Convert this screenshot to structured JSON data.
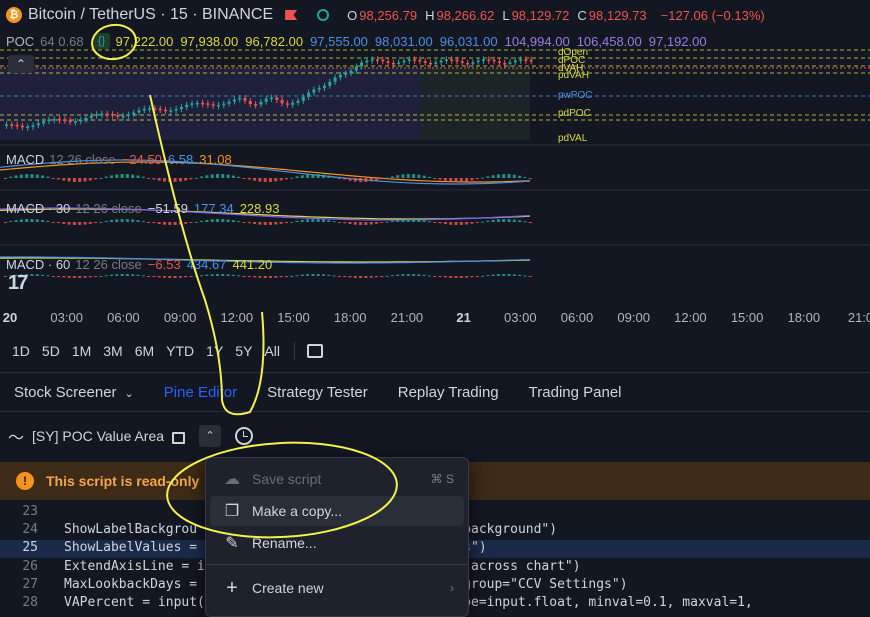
{
  "header": {
    "symbol": "Bitcoin / TetherUS · 15 · BINANCE",
    "ohlc": [
      {
        "k": "O",
        "v": "98,256.79"
      },
      {
        "k": "H",
        "v": "98,266.62"
      },
      {
        "k": "L",
        "v": "98,129.72"
      },
      {
        "k": "C",
        "v": "98,129.73"
      }
    ],
    "change": "−127.06 (−0.13%)"
  },
  "poc_indicator": {
    "label": "POC",
    "args": "64 0.68",
    "values": [
      {
        "v": "97,222.00",
        "color": "#d9d940"
      },
      {
        "v": "97,938.00",
        "color": "#d9d940"
      },
      {
        "v": "96,782.00",
        "color": "#d9d940"
      },
      {
        "v": "97,555.00",
        "color": "#4a90e2"
      },
      {
        "v": "98,031.00",
        "color": "#4a90e2"
      },
      {
        "v": "96,031.00",
        "color": "#4a90e2"
      },
      {
        "v": "104,994.00",
        "color": "#9b7be0"
      },
      {
        "v": "106,458.00",
        "color": "#9b7be0"
      },
      {
        "v": "97,192.00",
        "color": "#9b7be0"
      }
    ]
  },
  "level_labels": [
    {
      "text": "dOpen",
      "color": "#d9d940"
    },
    {
      "text": "dPOC",
      "color": "#d9d940"
    },
    {
      "text": "dVAH",
      "color": "#d9d940"
    },
    {
      "text": "pdVAH",
      "color": "#d9d940"
    },
    {
      "text": "pwPOC",
      "color": "#4a90e2"
    },
    {
      "text": "pdPOC",
      "color": "#d9d940"
    },
    {
      "text": "pdVAL",
      "color": "#d9d940"
    }
  ],
  "macd_panes": [
    {
      "label": "MACD",
      "args": "12 26 close",
      "values": [
        {
          "v": "−24.50",
          "color": "#ef5350"
        },
        {
          "v": "6.58",
          "color": "#4a90e2"
        },
        {
          "v": "31.08",
          "color": "#f7931a"
        }
      ]
    },
    {
      "label": "MACD · 30",
      "args": "12 26 close",
      "values": [
        {
          "v": "−51.59",
          "color": "#d1d4dc"
        },
        {
          "v": "177.34",
          "color": "#4a90e2"
        },
        {
          "v": "228.93",
          "color": "#d9d940"
        }
      ]
    },
    {
      "label": "MACD · 60",
      "args": "12 26 close",
      "values": [
        {
          "v": "−6.53",
          "color": "#ef5350"
        },
        {
          "v": "434.67",
          "color": "#4a90e2"
        },
        {
          "v": "441.20",
          "color": "#d9d940"
        }
      ]
    }
  ],
  "time_axis": [
    "20",
    "03:00",
    "06:00",
    "09:00",
    "12:00",
    "15:00",
    "18:00",
    "21:00",
    "21",
    "03:00",
    "06:00",
    "09:00",
    "12:00",
    "15:00",
    "18:00",
    "21:0"
  ],
  "ranges": [
    "1D",
    "5D",
    "1M",
    "3M",
    "6M",
    "YTD",
    "1Y",
    "5Y",
    "All"
  ],
  "tabs": [
    "Stock Screener",
    "Pine Editor",
    "Strategy Tester",
    "Replay Trading",
    "Trading Panel"
  ],
  "active_tab": "Pine Editor",
  "editor": {
    "script_name": "[SY] POC Value Area"
  },
  "banner": {
    "text": "This script is read-only"
  },
  "code": [
    {
      "n": "23",
      "t": ""
    },
    {
      "n": "24",
      "t": "ShowLabelBackgrou                                l background\")"
    },
    {
      "n": "25",
      "t": "ShowLabelValues =                                ues\")"
    },
    {
      "n": "26",
      "t": "ExtendAxisLine = i                              nes across chart\")"
    },
    {
      "n": "27",
      "t": "MaxLookbackDays =                        minval=0, group=\"CCV Settings\")"
    },
    {
      "n": "28",
      "t": "VAPercent = input(                    el 0.68)\", type=input.float, minval=0.1, maxval=1,"
    }
  ],
  "menu": {
    "items": [
      {
        "label": "Save script",
        "shortcut": "⌘ S",
        "icon": "cloud-upload-icon"
      },
      {
        "label": "Make a copy...",
        "shortcut": "",
        "icon": "copy-icon"
      },
      {
        "label": "Rename...",
        "shortcut": "",
        "icon": "pencil-icon"
      },
      {
        "label": "Create new",
        "shortcut": "›",
        "icon": "plus-icon"
      }
    ]
  },
  "colors": {
    "background": "#131722",
    "accent": "#2962ff",
    "up": "#26a69a",
    "down": "#ef5350",
    "annotation": "#f2f24a"
  }
}
